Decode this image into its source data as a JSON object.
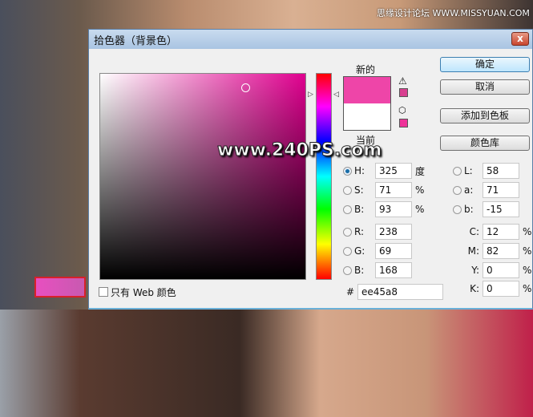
{
  "watermark_top": "思缘设计论坛 WWW.MISSYUAN.COM",
  "watermark_center": "www.240PS.com",
  "dialog": {
    "title": "拾色器（背景色）",
    "close": "x"
  },
  "swatch": {
    "new_label": "新的",
    "current_label": "当前",
    "new_color": "#ee45a8",
    "current_color": "#ffffff"
  },
  "buttons": {
    "ok": "确定",
    "cancel": "取消",
    "add_swatch": "添加到色板",
    "libraries": "颜色库"
  },
  "hsb": {
    "h_label": "H:",
    "h": "325",
    "h_unit": "度",
    "s_label": "S:",
    "s": "71",
    "s_unit": "%",
    "b_label": "B:",
    "b": "93",
    "b_unit": "%"
  },
  "rgb": {
    "r_label": "R:",
    "r": "238",
    "g_label": "G:",
    "g": "69",
    "b_label": "B:",
    "b": "168"
  },
  "lab": {
    "l_label": "L:",
    "l": "58",
    "a_label": "a:",
    "a": "71",
    "b_label": "b:",
    "b": "-15"
  },
  "cmyk": {
    "c_label": "C:",
    "c": "12",
    "m_label": "M:",
    "m": "82",
    "y_label": "Y:",
    "y": "0",
    "k_label": "K:",
    "k": "0",
    "unit": "%"
  },
  "hex": {
    "label": "#",
    "value": "ee45a8"
  },
  "web_only": "只有 Web 颜色"
}
